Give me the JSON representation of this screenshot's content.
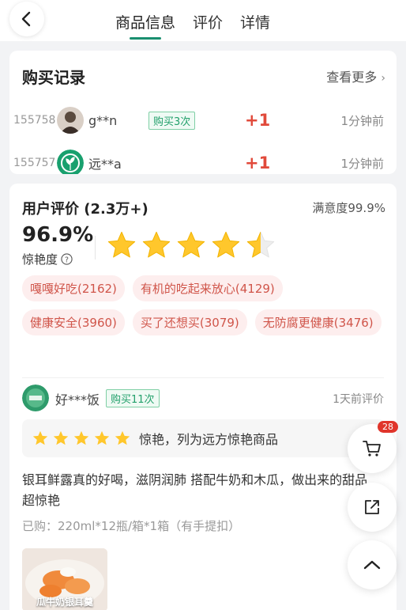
{
  "header": {
    "tabs": [
      {
        "label": "商品信息",
        "active": true
      },
      {
        "label": "评价",
        "active": false
      },
      {
        "label": "详情",
        "active": false
      }
    ],
    "accent_color": "#1a8f6f"
  },
  "purchase": {
    "title": "购买记录",
    "more": "查看更多",
    "rows": [
      {
        "id": "155758",
        "name": "g**n",
        "tag": "购买3次",
        "plus": "+1",
        "time": "1分钟前"
      },
      {
        "id": "155757",
        "name": "远**a",
        "tag": "",
        "plus": "+1",
        "time": "1分钟前"
      }
    ]
  },
  "reviews": {
    "title": "用户评价 (2.3万+)",
    "satisfaction": "满意度99.9%",
    "percent": "96.9%",
    "percent_label": "惊艳度",
    "rating": 4.5,
    "tags": [
      "嘎嘎好吃(2162)",
      "有机的吃起来放心(4129)",
      "健康安全(3960)",
      "买了还想买(3079)",
      "无防腐更健康(3476)"
    ],
    "review": {
      "user": "好***饭",
      "tag": "购买11次",
      "time": "1天前评价",
      "stars": 5,
      "verdict": "惊艳，列为远方惊艳商品",
      "text": "银耳鲜露真的好喝，滋阴润肺 搭配牛奶和木瓜，做出来的甜品超惊艳",
      "bought": "已购：220ml*12瓶/箱*1箱（有手提扣）",
      "image_label": "瓜牛奶银耳羹"
    }
  },
  "float": {
    "cart_badge": "28"
  }
}
